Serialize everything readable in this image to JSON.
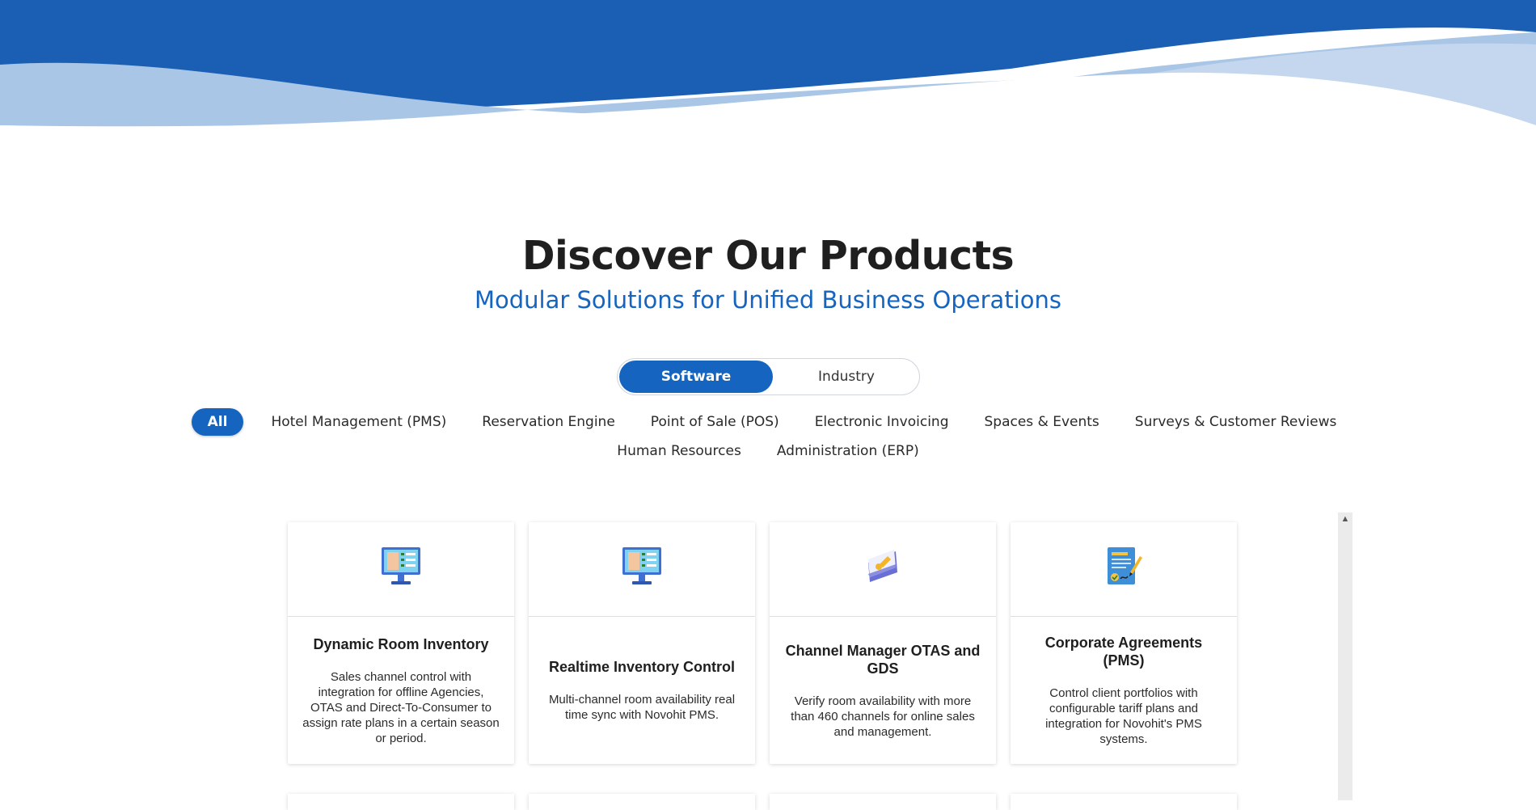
{
  "colors": {
    "brand_blue": "#1565c0",
    "wave_light": "#a9c6e6",
    "text_dark": "#1f1f1f"
  },
  "page": {
    "title": "Discover Our Products",
    "subtitle": "Modular Solutions for Unified Business Operations"
  },
  "toggle": {
    "software_label": "Software",
    "industry_label": "Industry",
    "selected": "Software"
  },
  "filters": {
    "row1": [
      "All",
      "Hotel Management (PMS)",
      "Reservation Engine",
      "Point of Sale (POS)",
      "Electronic Invoicing",
      "Spaces & Events",
      "Surveys & Customer Reviews"
    ],
    "row2": [
      "Human Resources",
      "Administration (ERP)"
    ],
    "selected": "All"
  },
  "cards": [
    {
      "icon": "monitor-checklist-icon",
      "title": "Dynamic Room Inventory",
      "description": "Sales channel control with integration for offline Agencies, OTAS and Direct-To-Consumer to assign rate plans in a certain season or period."
    },
    {
      "icon": "monitor-checklist-icon",
      "title": "Realtime Inventory Control",
      "description": "Multi-channel room availability real time sync with Novohit PMS."
    },
    {
      "icon": "card-key-icon",
      "title": "Channel Manager OTAS and GDS",
      "description": "Verify room availability with more than 460 channels for online sales and management."
    },
    {
      "icon": "contract-signature-icon",
      "title": "Corporate Agreements (PMS)",
      "description": "Control client portfolios with configurable tariff plans and integration for Novohit's PMS systems."
    }
  ]
}
